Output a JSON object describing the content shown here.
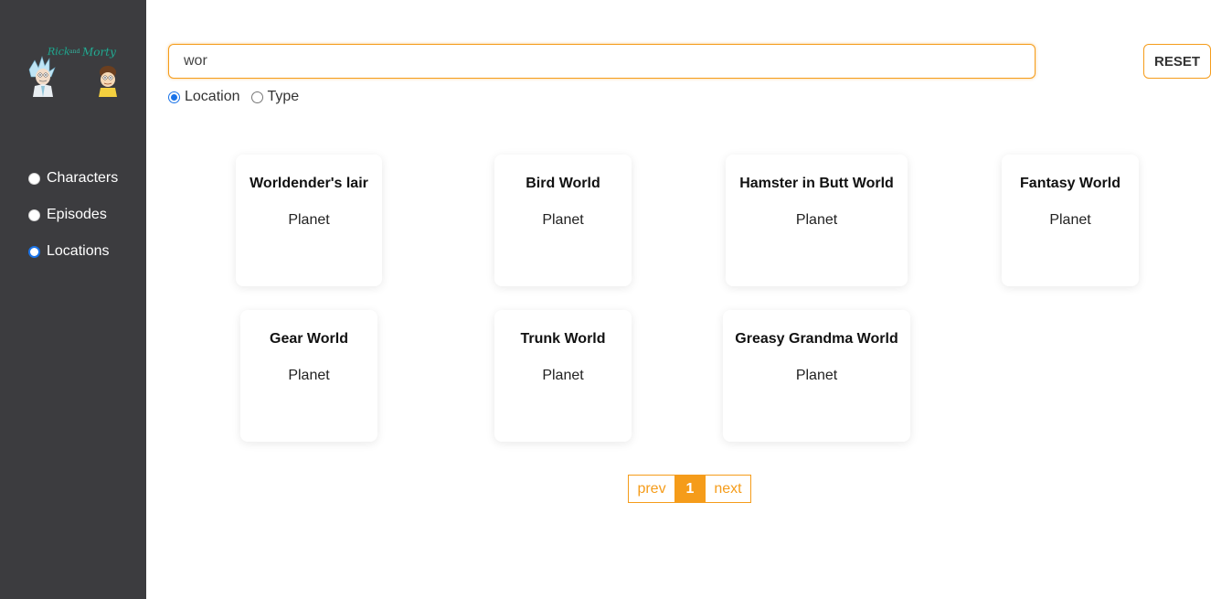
{
  "app": {
    "logo_name": "rick-and-morty-logo",
    "accent_color": "#f59c1a",
    "sidebar_color": "#3c3c3f"
  },
  "sidebar": {
    "items": [
      {
        "label": "Characters",
        "checked": false
      },
      {
        "label": "Episodes",
        "checked": false
      },
      {
        "label": "Locations",
        "checked": true
      }
    ]
  },
  "search": {
    "value": "wor",
    "reset_label": "RESET"
  },
  "filters": {
    "options": [
      {
        "label": "Location",
        "checked": true
      },
      {
        "label": "Type",
        "checked": false
      }
    ]
  },
  "results": [
    {
      "name": "Worldender's lair",
      "type": "Planet"
    },
    {
      "name": "Bird World",
      "type": "Planet"
    },
    {
      "name": "Hamster in Butt World",
      "type": "Planet"
    },
    {
      "name": "Fantasy World",
      "type": "Planet"
    },
    {
      "name": "Gear World",
      "type": "Planet"
    },
    {
      "name": "Trunk World",
      "type": "Planet"
    },
    {
      "name": "Greasy Grandma World",
      "type": "Planet"
    }
  ],
  "pagination": {
    "prev_label": "prev",
    "current_page": "1",
    "next_label": "next"
  }
}
